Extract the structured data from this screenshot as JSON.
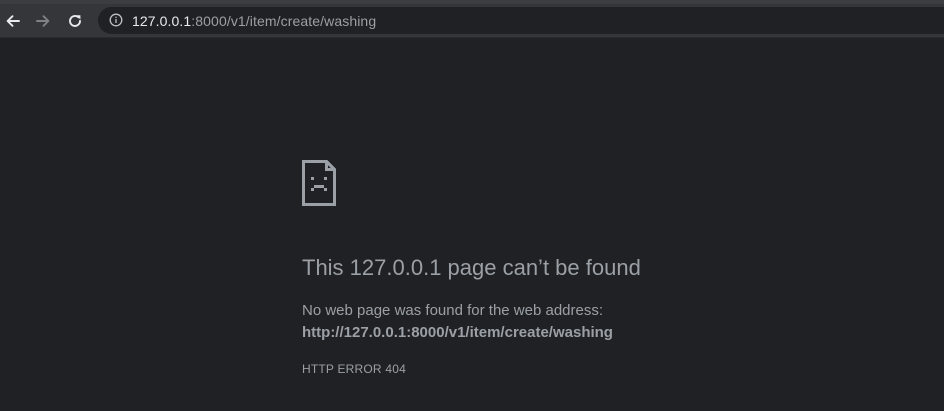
{
  "browser": {
    "address_bar": {
      "host": "127.0.0.1",
      "rest": ":8000/v1/item/create/washing"
    },
    "icons": {
      "back": "arrow-left-icon",
      "forward": "arrow-right-icon",
      "reload": "reload-icon",
      "site_info": "info-circle-icon"
    }
  },
  "error_page": {
    "icon": "sad-document-icon",
    "headline": "This 127.0.0.1 page can’t be found",
    "description": "No web page was found for the web address:",
    "url": "http://127.0.0.1:8000/v1/item/create/washing",
    "error_code": "HTTP ERROR 404"
  },
  "colors": {
    "background": "#202124",
    "toolbar": "#35363a",
    "text_muted": "#9aa0a6",
    "text_bright": "#e8eaed"
  }
}
